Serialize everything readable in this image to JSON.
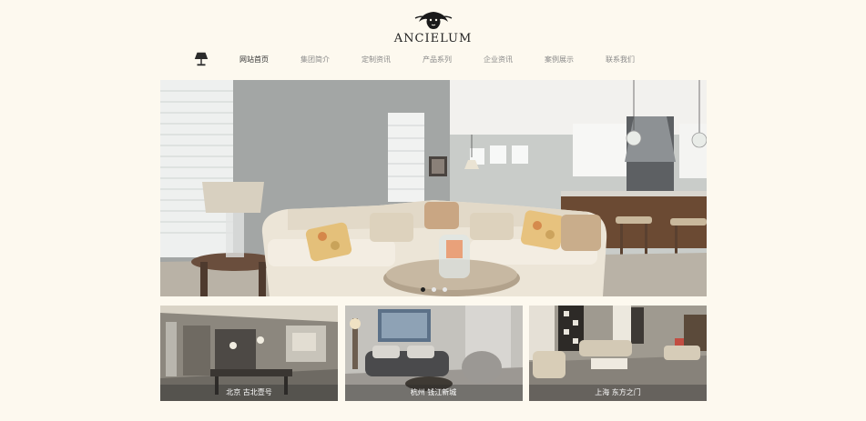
{
  "brand": {
    "name": "ANCIELUM"
  },
  "nav": {
    "items": [
      {
        "label": "网站首页",
        "active": true
      },
      {
        "label": "集团简介",
        "active": false
      },
      {
        "label": "定制资讯",
        "active": false
      },
      {
        "label": "产品系列",
        "active": false
      },
      {
        "label": "企业资讯",
        "active": false
      },
      {
        "label": "案例展示",
        "active": false
      },
      {
        "label": "联系我们",
        "active": false
      }
    ]
  },
  "hero": {
    "slide_count": 3,
    "active_slide": 1
  },
  "projects": [
    {
      "caption": "北京 古北壹号"
    },
    {
      "caption": "杭州 钱江新城"
    },
    {
      "caption": "上海 东方之门"
    }
  ],
  "colors": {
    "background": "#fdf9ef",
    "active_dot": "#222222"
  }
}
